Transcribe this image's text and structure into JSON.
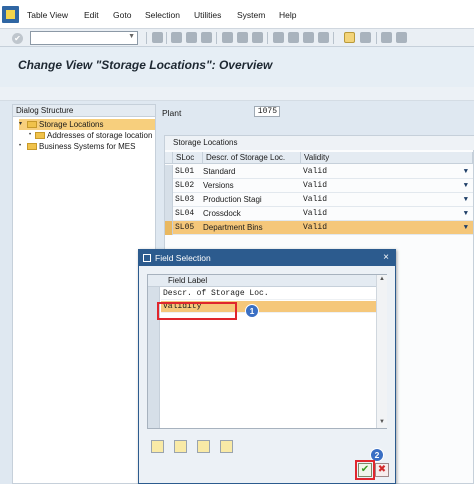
{
  "menu": [
    "Table View",
    "Edit",
    "Goto",
    "Selection",
    "Utilities",
    "System",
    "Help"
  ],
  "title": "Change View \"Storage Locations\": Overview",
  "tree": {
    "header": "Dialog Structure",
    "items": [
      {
        "label": "Storage Locations"
      },
      {
        "label": "Addresses of storage location"
      },
      {
        "label": "Business Systems for MES"
      }
    ]
  },
  "plant": {
    "label": "Plant",
    "value": "1075"
  },
  "table": {
    "title": "Storage Locations",
    "headers": [
      "SLoc",
      "Descr. of Storage Loc.",
      "Validity"
    ],
    "rows": [
      {
        "code": "SL01",
        "desc": "Standard",
        "validity": "Valid"
      },
      {
        "code": "SL02",
        "desc": "Versions",
        "validity": "Valid"
      },
      {
        "code": "SL03",
        "desc": "Production Stagi",
        "validity": "Valid"
      },
      {
        "code": "SL04",
        "desc": "Crossdock",
        "validity": "Valid"
      },
      {
        "code": "SL05",
        "desc": "Department Bins",
        "validity": "Valid"
      }
    ]
  },
  "popup": {
    "title": "Field Selection",
    "close": "×",
    "list_header": "Field Label",
    "fields": [
      "Descr. of Storage Loc.",
      "Validity"
    ]
  },
  "badges": [
    "1",
    "2"
  ],
  "icons": {
    "check": "✔",
    "cancel": "✖",
    "dropdown": "▼",
    "scroll_up": "▲",
    "scroll_down": "▼",
    "tree_expanded": "▾",
    "tree_collapsed": "•"
  },
  "colors": {
    "title_bar": "#2c5b8e",
    "selection": "#f5c77a",
    "highlight_box": "#e0262d",
    "badge": "#3a6fc4"
  }
}
